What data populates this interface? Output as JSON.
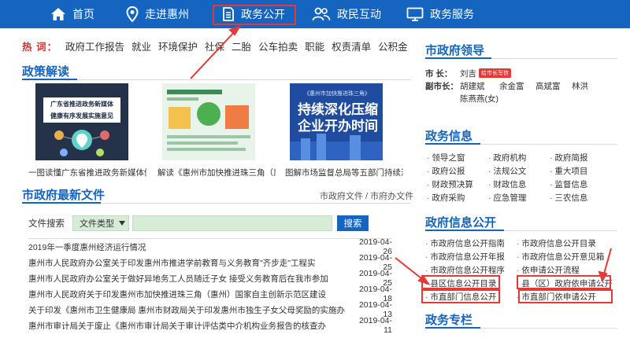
{
  "nav": {
    "items": [
      {
        "label": "首页",
        "icon": "home-icon"
      },
      {
        "label": "走进惠州",
        "icon": "location-pin-icon"
      },
      {
        "label": "政务公开",
        "icon": "document-icon"
      },
      {
        "label": "政民互动",
        "icon": "people-icon"
      },
      {
        "label": "政务服务",
        "icon": "monitor-icon"
      }
    ]
  },
  "hot": {
    "label": "热 词：",
    "links": [
      "政府工作报告",
      "就业",
      "环境保护",
      "社保",
      "二胎",
      "公车拍卖",
      "职能",
      "权责清单",
      "公积金"
    ]
  },
  "policy": {
    "title": "政策解读",
    "thumb1_lines": [
      "广东省推进政务新媒体",
      "健康有序发展实施意见"
    ],
    "thumb3_top": "《惠州市加快推进珠三角》",
    "thumb3_lines": [
      "持续深化压缩",
      "企业开办时间"
    ],
    "captions": [
      "一图读懂广东省推进政务新媒体健...",
      "解读《惠州市加快推进珠三角（惠...",
      "图解市场监督总局等五部门持续深..."
    ]
  },
  "files": {
    "title": "市政府最新文件",
    "links": "市政府文件 / 市府办文件",
    "search_label": "文件搜索",
    "type_select": "文件类型",
    "search_button": "搜索",
    "rows": [
      {
        "title": "2019年一季度惠州经济运行情况",
        "date": "2019-04-26"
      },
      {
        "title": "惠州市人民政府办公室关于印发惠州市推进学前教育与义务教育\"齐步走\"工程实",
        "date": "2019-04-25"
      },
      {
        "title": "惠州市人民政府办公室关于做好异地务工人员随迁子女 接受义务教育后在我市参加",
        "date": "2019-04-25"
      },
      {
        "title": "惠州市人民政府关于印发惠州市加快推进珠三角（惠州）国家自主创新示范区建设",
        "date": "2019-04-18"
      },
      {
        "title": "关于印发《惠州市卫生健康局 惠州市财政局关于印发惠州市独生子女父母奖励的实施办",
        "date": "2019-04-13"
      },
      {
        "title": "惠州市审计局关于废止《惠州市审计局关于审计评估类中介机构业务报告的核查办",
        "date": "2019-04-11"
      }
    ]
  },
  "leaders": {
    "title": "市政府领导",
    "mayor_label": "市  长：",
    "mayor": "刘吉",
    "badge": "给市长写信",
    "vice_label": "副市长：",
    "vice": [
      "胡建斌",
      "余金富",
      "高斌富",
      "林洪",
      "陈燕燕(女)"
    ]
  },
  "affairs": {
    "title": "政务信息",
    "links": [
      "领导之窗",
      "政府机构",
      "政府简报",
      "政府公报",
      "法规公文",
      "重大项目",
      "财政预决算",
      "财政信息",
      "监督信息",
      "政府采购",
      "应急管理",
      "三农信息"
    ]
  },
  "disclosure": {
    "title": "政府信息公开",
    "links": [
      "市政府信息公开指南",
      "市政府信息公开目录",
      "市政府信息公开年报",
      "市政府信息公开意见箱",
      "市政府信息公开程序",
      "依申请公开流程",
      "县区信息公开目录",
      "县（区）政府依申请公开",
      "市直部门信息公开",
      "市直部门依申请公开"
    ]
  },
  "column": {
    "title": "政务专栏"
  },
  "colors": {
    "nav": "#1565c0",
    "accent": "#1565c0",
    "hot": "#d32f2f",
    "annotation": "#e53935",
    "search_field": "#d7ecd7"
  }
}
